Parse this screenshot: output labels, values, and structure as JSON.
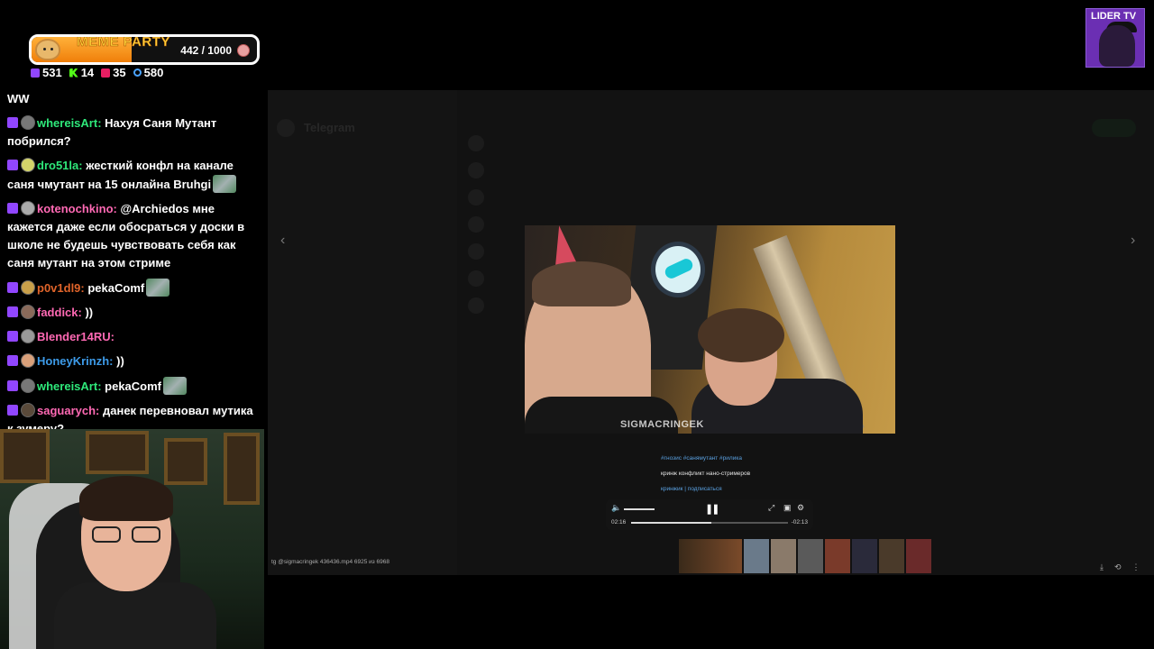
{
  "overlay": {
    "goal_title": "MEME PARTY",
    "goal_current": "442 / 1000",
    "goal_progress": 0.442,
    "stats": [
      {
        "platform": "twitch",
        "icon": "twitch-icon",
        "count": "531"
      },
      {
        "platform": "kick",
        "icon": "kick-icon",
        "count": "14"
      },
      {
        "platform": "live",
        "icon": "live-icon",
        "count": "35"
      },
      {
        "platform": "viewers",
        "icon": "viewers-icon",
        "count": "580"
      }
    ]
  },
  "chat": {
    "first_line": "WW",
    "messages": [
      {
        "user": "whereisArt:",
        "user_color": "#2ee87a",
        "text": " Нахуя Саня Мутант побрился?",
        "avatar_color": "#777",
        "emote": false
      },
      {
        "user": "dro51la:",
        "user_color": "#2ee87a",
        "text": " жесткий конфл на канале саня чмутант на 15 онлайна Bruhgi",
        "avatar_color": "#d4d46a",
        "emote": true
      },
      {
        "user": "kotenochkino:",
        "user_color": "#ff69b4",
        "text": " @Archiedos мне кажется даже если обосраться у доски в школе не будешь чувствовать себя как саня мутант на этом стриме",
        "avatar_color": "#aaa",
        "emote": false
      },
      {
        "user": "p0v1dl9:",
        "user_color": "#e0642a",
        "text": " pekaComf",
        "avatar_color": "#c9a04a",
        "emote": true
      },
      {
        "user": "faddick:",
        "user_color": "#ff69b4",
        "text": " ))",
        "avatar_color": "#8a6a5a",
        "emote": false
      },
      {
        "user": "Blender14RU:",
        "user_color": "#ff69b4",
        "text": "",
        "avatar_color": "#999",
        "emote": false
      },
      {
        "user": "HoneyKrinzh:",
        "user_color": "#3d9be9",
        "text": " ))",
        "avatar_color": "#d9a07a",
        "emote": false
      },
      {
        "user": "whereisArt:",
        "user_color": "#2ee87a",
        "text": " pekaComf",
        "avatar_color": "#777",
        "emote": true
      },
      {
        "user": "saguarych:",
        "user_color": "#ff69b4",
        "text": " данек перевновал мутика к зумеру?",
        "avatar_color": "#5a4a3a",
        "emote": false
      }
    ]
  },
  "telegram": {
    "app_title": "Telegram",
    "video_watermark": "SIGMACRINGEK",
    "caption_tags": "#гнозис #санямутант #рилика",
    "caption_text": "кринж конфликт нано-стримеров",
    "caption_links": "кринжик | подписаться",
    "player_time_current": "02:16",
    "player_time_remaining": "-02:13",
    "player_progress": 0.51,
    "file_info": "tg @sigmacringek 436436.mp4 6925 из 6968"
  },
  "channel_logo": {
    "name": "LIDER TV"
  }
}
